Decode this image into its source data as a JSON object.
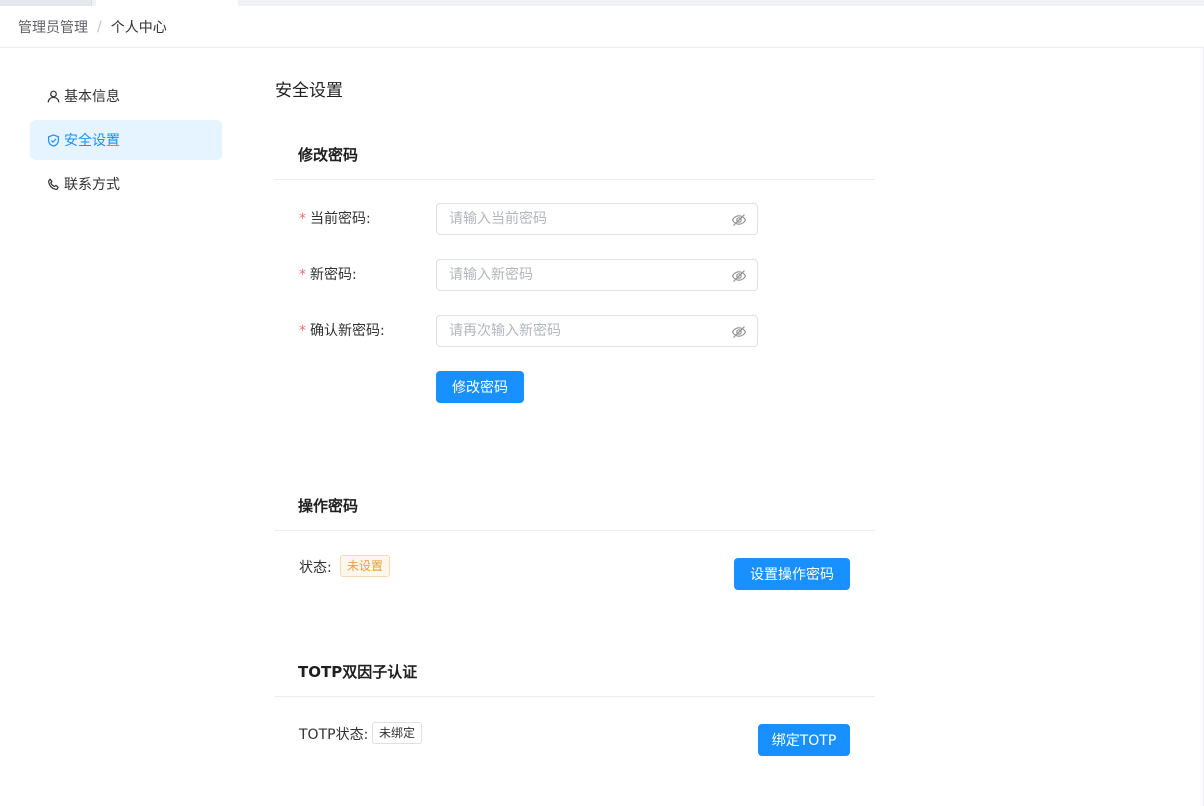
{
  "breadcrumb": {
    "items": [
      "管理员管理",
      "个人中心"
    ],
    "separator": "/"
  },
  "sidebar": {
    "items": [
      {
        "label": "基本信息",
        "icon": "user-icon",
        "active": false
      },
      {
        "label": "安全设置",
        "icon": "shield-icon",
        "active": true
      },
      {
        "label": "联系方式",
        "icon": "phone-icon",
        "active": false
      }
    ]
  },
  "page": {
    "title": "安全设置"
  },
  "change_password": {
    "title": "修改密码",
    "fields": [
      {
        "label": "当前密码:",
        "placeholder": "请输入当前密码",
        "value": ""
      },
      {
        "label": "新密码:",
        "placeholder": "请输入新密码",
        "value": ""
      },
      {
        "label": "确认新密码:",
        "placeholder": "请再次输入新密码",
        "value": ""
      }
    ],
    "required_mark": "*",
    "submit_label": "修改密码"
  },
  "operation_password": {
    "title": "操作密码",
    "status_label": "状态:",
    "status_value": "未设置",
    "button_label": "设置操作密码"
  },
  "totp": {
    "title": "TOTP双因子认证",
    "status_label": "TOTP状态:",
    "status_value": "未绑定",
    "button_label": "绑定TOTP"
  },
  "colors": {
    "primary": "#1890ff",
    "active_bg": "#e6f4ff",
    "required": "#f56c6c",
    "warning": "#e6a23c"
  }
}
